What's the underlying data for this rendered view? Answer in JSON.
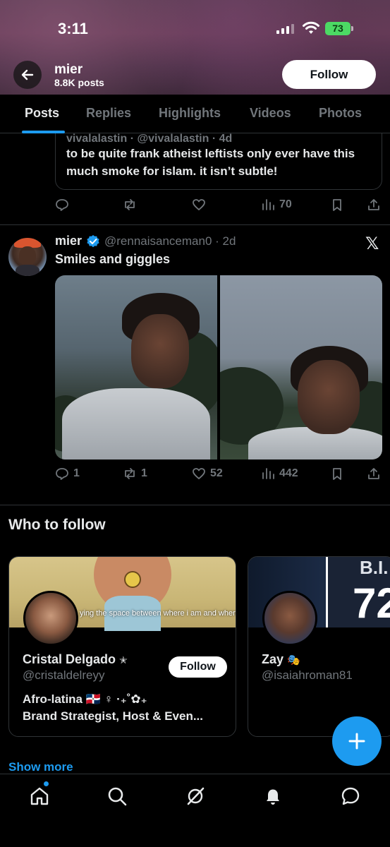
{
  "status_bar": {
    "time": "3:11",
    "battery": "73"
  },
  "header": {
    "name": "mier",
    "posts_count": "8.8K posts",
    "follow_label": "Follow"
  },
  "tabs": [
    {
      "label": "Posts",
      "active": true
    },
    {
      "label": "Replies"
    },
    {
      "label": "Highlights"
    },
    {
      "label": "Videos"
    },
    {
      "label": "Photos"
    }
  ],
  "quoted_post": {
    "header_cut": "vivalalastin · @vivalalastin · 4d",
    "text": "to be quite frank atheist leftists only ever have this much smoke for islam. it isn’t subtle!",
    "actions": {
      "replies": "",
      "reposts": "",
      "likes": "",
      "views": "70"
    }
  },
  "post": {
    "author": "mier",
    "handle": "@rennaisanceman0",
    "time": "· 2d",
    "text": "Smiles and giggles",
    "actions": {
      "replies": "1",
      "reposts": "1",
      "likes": "52",
      "views": "442"
    }
  },
  "who_to_follow": {
    "title": "Who to follow",
    "cards": [
      {
        "name": "Cristal Delgado",
        "badge": "✭",
        "handle": "@cristaldelreyy",
        "banner_caption": "ying the space between where i am and where im going",
        "bio_line1": "Afro-latina 🇩🇴 ♀ ·₊˚✿₊",
        "bio_line2": "Brand Strategist, Host & Even...",
        "follow_label": "Follow"
      },
      {
        "name": "Zay",
        "badge": "🎭",
        "handle": "@isaiahroman81",
        "banner_text": "B.I.",
        "banner_number": "72"
      }
    ],
    "show_more": "Show more"
  },
  "colors": {
    "accent": "#1d9bf0",
    "muted": "#71767b",
    "text": "#e7e9ea",
    "border": "#2f3336"
  },
  "icons": [
    "back-arrow-icon",
    "reply-icon",
    "repost-icon",
    "like-icon",
    "views-icon",
    "bookmark-icon",
    "share-icon",
    "verified-icon",
    "x-logo-icon",
    "plus-icon",
    "home-icon",
    "search-icon",
    "grok-icon",
    "notifications-icon",
    "messages-icon"
  ]
}
